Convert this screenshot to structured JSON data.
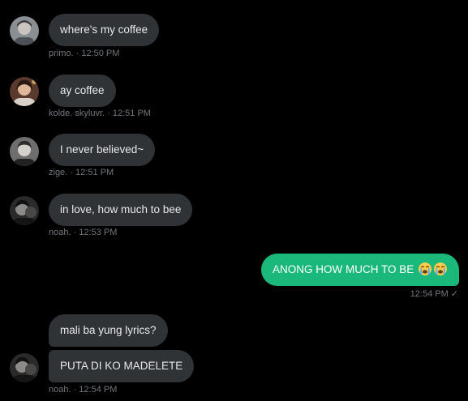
{
  "messages": [
    {
      "text": "where's my coffee",
      "author": "primo.",
      "time": "12:50 PM"
    },
    {
      "text": "ay coffee",
      "author": "kolde. skyluvr.",
      "time": "12:51 PM"
    },
    {
      "text": "I never believed~",
      "author": "zige.",
      "time": "12:51 PM"
    },
    {
      "text": "in love, how much to bee",
      "author": "noah.",
      "time": "12:53 PM"
    },
    {
      "text": "ANONG HOW MUCH TO BE",
      "emojis": [
        "loudly-crying-face",
        "loudly-crying-face"
      ],
      "time": "12:54 PM",
      "status": "✓"
    },
    {
      "text": "mali ba yung lyrics?"
    },
    {
      "text": "PUTA DI KO MADELETE",
      "author": "noah.",
      "time": "12:54 PM"
    }
  ],
  "meta_separator": " · ",
  "colors": {
    "background": "#000000",
    "incoming_bubble": "#2f3336",
    "outgoing_bubble": "#1ab87a",
    "meta_text": "#71767b"
  }
}
